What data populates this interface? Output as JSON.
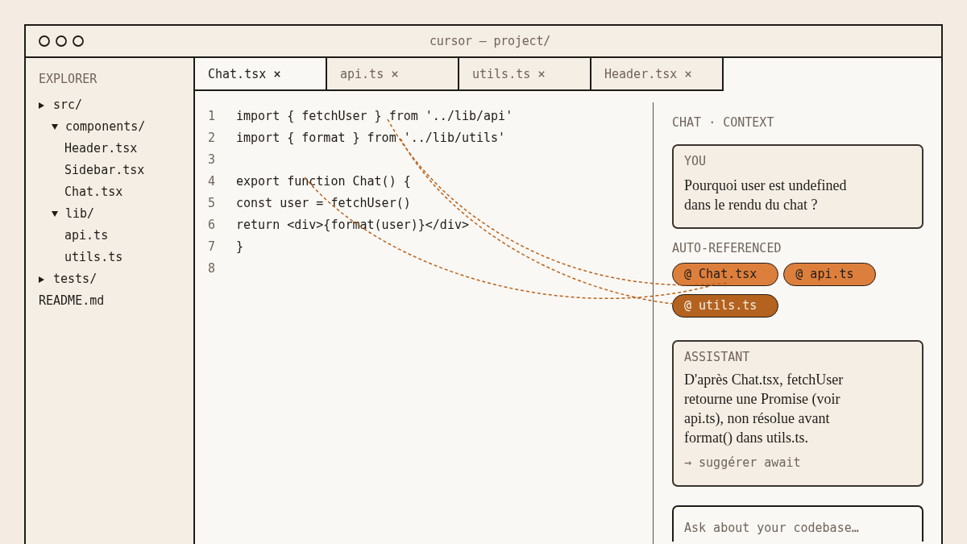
{
  "window": {
    "title": "cursor — project/"
  },
  "explorer": {
    "title": "EXPLORER",
    "items": [
      {
        "name": "src/",
        "kind": "folder",
        "expanded": false,
        "children": [
          {
            "name": "components/",
            "kind": "folder",
            "expanded": true,
            "children": [
              {
                "name": "Header.tsx",
                "kind": "file"
              },
              {
                "name": "Sidebar.tsx",
                "kind": "file"
              },
              {
                "name": "Chat.tsx",
                "kind": "file"
              }
            ]
          },
          {
            "name": "lib/",
            "kind": "folder",
            "expanded": true,
            "children": [
              {
                "name": "api.ts",
                "kind": "file"
              },
              {
                "name": "utils.ts",
                "kind": "file"
              }
            ]
          }
        ]
      },
      {
        "name": "tests/",
        "kind": "folder",
        "expanded": false
      },
      {
        "name": "README.md",
        "kind": "file"
      }
    ]
  },
  "tabs": [
    {
      "label": "Chat.tsx",
      "selected": true
    },
    {
      "label": "api.ts",
      "selected": false
    },
    {
      "label": "utils.ts",
      "selected": false
    },
    {
      "label": "Header.tsx",
      "selected": false
    }
  ],
  "editor": {
    "lines": [
      {
        "number": "1",
        "code": "import { fetchUser } from '../lib/api'"
      },
      {
        "number": "2",
        "code": "import { format } from '../lib/utils'"
      },
      {
        "number": "3"
      },
      {
        "number": "4",
        "code": "export function Chat() {"
      },
      {
        "number": "5",
        "code": "const user = fetchUser()"
      },
      {
        "number": "6",
        "code": "return <div>{format(user)}</div>"
      },
      {
        "number": "7",
        "code": "}"
      },
      {
        "number": "8"
      }
    ]
  },
  "chat": {
    "title": "CHAT · CONTEXT",
    "question": {
      "author": "YOU",
      "text": "Pourquoi user est undefined dans le rendu du chat ?"
    },
    "references": {
      "title": "AUTO-REFERENCED",
      "items": [
        {
          "label": "@ Chat.tsx",
          "selected": false
        },
        {
          "label": "@ api.ts",
          "selected": false
        },
        {
          "label": "@ utils.ts",
          "selected": true
        }
      ]
    },
    "answer": {
      "author": "ASSISTANT",
      "text": "D'après Chat.tsx, fetchUser retourne une Promise (voir api.ts), non résolue avant format() dans utils.ts.",
      "action": "→ suggérer await"
    },
    "input": {
      "placeholder": "Ask about your codebase…"
    }
  }
}
